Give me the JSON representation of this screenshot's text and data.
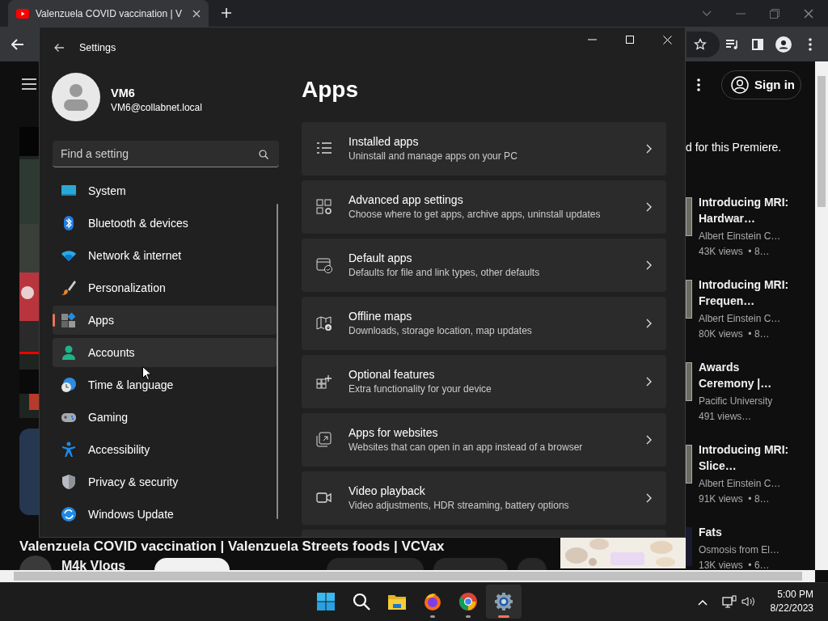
{
  "browser": {
    "tab": {
      "title": "Valenzuela COVID vaccination | V"
    },
    "youtube": {
      "sign_in": "Sign in",
      "premiere_note": "d for this Premiere.",
      "video_title": "Valenzuela COVID vaccination | Valenzuela Streets foods | VCVax",
      "channel": "M4k Vlogs",
      "related": [
        {
          "title": "Introducing MRI: Hardwar…",
          "channel": "Albert Einstein C…",
          "meta": "43K views  • 8…"
        },
        {
          "title": "Introducing MRI: Frequen…",
          "channel": "Albert Einstein C…",
          "meta": "80K views  • 8…"
        },
        {
          "title": "Awards Ceremony |…",
          "channel": "Pacific University",
          "meta": "491 views…"
        },
        {
          "title": "Introducing MRI: Slice…",
          "channel": "Albert Einstein C…",
          "meta": "91K views  • 8…"
        },
        {
          "title": "Fats",
          "channel": "Osmosis from El…",
          "meta": "13K views  • 6…"
        }
      ]
    }
  },
  "settings": {
    "window": {
      "title": "Settings"
    },
    "user": {
      "name": "VM6",
      "email": "VM6@collabnet.local"
    },
    "search": {
      "placeholder": "Find a setting"
    },
    "nav": [
      {
        "label": "System",
        "selected": false,
        "hovered": false
      },
      {
        "label": "Bluetooth & devices",
        "selected": false,
        "hovered": false
      },
      {
        "label": "Network & internet",
        "selected": false,
        "hovered": false
      },
      {
        "label": "Personalization",
        "selected": false,
        "hovered": false
      },
      {
        "label": "Apps",
        "selected": true,
        "hovered": false
      },
      {
        "label": "Accounts",
        "selected": false,
        "hovered": true
      },
      {
        "label": "Time & language",
        "selected": false,
        "hovered": false
      },
      {
        "label": "Gaming",
        "selected": false,
        "hovered": false
      },
      {
        "label": "Accessibility",
        "selected": false,
        "hovered": false
      },
      {
        "label": "Privacy & security",
        "selected": false,
        "hovered": false
      },
      {
        "label": "Windows Update",
        "selected": false,
        "hovered": false
      }
    ],
    "heading": "Apps",
    "cards": [
      {
        "title": "Installed apps",
        "description": "Uninstall and manage apps on your PC"
      },
      {
        "title": "Advanced app settings",
        "description": "Choose where to get apps, archive apps, uninstall updates"
      },
      {
        "title": "Default apps",
        "description": "Defaults for file and link types, other defaults"
      },
      {
        "title": "Offline maps",
        "description": "Downloads, storage location, map updates"
      },
      {
        "title": "Optional features",
        "description": "Extra functionality for your device"
      },
      {
        "title": "Apps for websites",
        "description": "Websites that can open in an app instead of a browser"
      },
      {
        "title": "Video playback",
        "description": "Video adjustments, HDR streaming, battery options"
      }
    ]
  },
  "taskbar": {
    "apps": [
      {
        "active": false
      },
      {
        "active": false
      },
      {
        "active": false
      },
      {
        "active": false,
        "running": true
      },
      {
        "active": false,
        "running": true
      },
      {
        "active": true,
        "running": true
      }
    ],
    "time": "5:00 PM",
    "date": "8/22/2023"
  }
}
